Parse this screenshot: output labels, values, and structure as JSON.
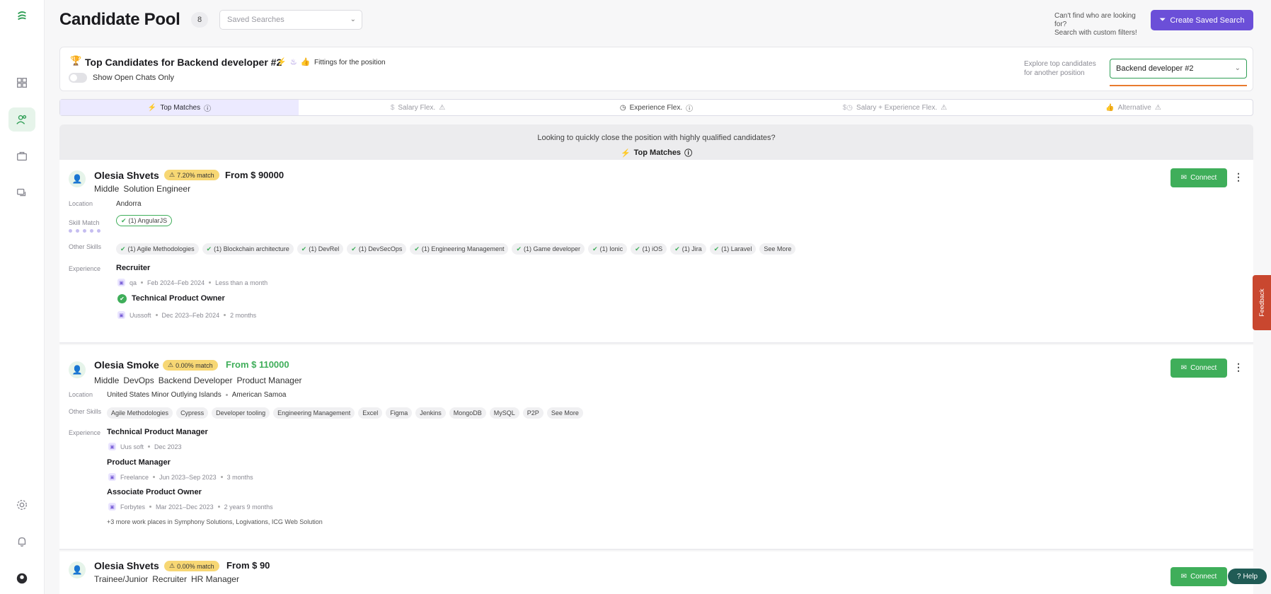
{
  "header": {
    "title": "Candidate Pool",
    "count": "8",
    "saved_searches_placeholder": "Saved Searches",
    "cant_find_line1": "Can't find who are looking for?",
    "cant_find_line2": "Search with custom filters!",
    "create_saved_search": "Create Saved Search"
  },
  "position": {
    "title": "Top Candidates for Backend developer #2",
    "fittings": "Fittings for the position",
    "show_open_chats": "Show Open Chats Only",
    "explore_line1": "Explore top candidates",
    "explore_line2": "for another position",
    "selected": "Backend developer #2"
  },
  "tabs": [
    {
      "label": "Top Matches",
      "active": true
    },
    {
      "label": "Salary Flex.",
      "active": false
    },
    {
      "label": "Experience Flex.",
      "active": false
    },
    {
      "label": "Salary + Experience Flex.",
      "active": false
    },
    {
      "label": "Alternative",
      "active": false
    }
  ],
  "banner": {
    "text": "Looking to quickly close the position with highly qualified candidates?",
    "sub": "Top Matches"
  },
  "labels": {
    "location": "Location",
    "skill_match": "Skill Match",
    "other_skills": "Other Skills",
    "experience": "Experience",
    "connect": "Connect",
    "see_more": "See More"
  },
  "candidates": [
    {
      "name": "Olesia Shvets",
      "match": "7.20% match",
      "salary": "From $ 90000",
      "roles": [
        "Middle",
        "Solution Engineer"
      ],
      "locations": [
        "Andorra"
      ],
      "skill_match": [
        "(1)  AngularJS"
      ],
      "other_skills": [
        "(1)  Agile Methodologies",
        "(1)  Blockchain architecture",
        "(1)  DevRel",
        "(1)  DevSecOps",
        "(1)  Engineering Management",
        "(1)  Game developer",
        "(1)  Ionic",
        "(1)  iOS",
        "(1)  Jira",
        "(1)  Laravel"
      ],
      "experience": [
        {
          "title": "Recruiter",
          "company": "qa",
          "period": "Feb 2024–Feb 2024",
          "duration": "Less than a month"
        },
        {
          "title": "Technical Product Owner",
          "company": "Uussoft",
          "period": "Dec 2023–Feb 2024",
          "duration": "2 months"
        }
      ]
    },
    {
      "name": "Olesia Smoke",
      "match": "0.00% match",
      "salary": "From $ 110000",
      "roles": [
        "Middle",
        "DevOps",
        "Backend Developer",
        "Product Manager"
      ],
      "locations": [
        "United States Minor Outlying Islands",
        "American Samoa"
      ],
      "other_skills": [
        "Agile Methodologies",
        "Cypress",
        "Developer tooling",
        "Engineering Management",
        "Excel",
        "Figma",
        "Jenkins",
        "MongoDB",
        "MySQL",
        "P2P"
      ],
      "experience": [
        {
          "title": "Technical Product Manager",
          "company": "Uus soft",
          "period": "Dec 2023",
          "duration": ""
        },
        {
          "title": "Product Manager",
          "company": "Freelance",
          "period": "Jun 2023–Sep 2023",
          "duration": "3 months"
        },
        {
          "title": "Associate Product Owner",
          "company": "Forbytes",
          "period": "Mar 2021–Dec 2023",
          "duration": "2 years 9 months"
        }
      ],
      "more_places": "+3 more work places in Symphony Solutions, Logivations, ICG Web Solution"
    },
    {
      "name": "Olesia Shvets",
      "match": "0.00% match",
      "salary": "From $ 90",
      "roles": [
        "Trainee/Junior",
        "Recruiter",
        "HR Manager"
      ]
    }
  ],
  "feedback": "Feedback",
  "help": "Help",
  "colors": {
    "accent": "#6b4fd8",
    "green": "#3fae5a",
    "match": "#f7d774",
    "feedback": "#c9472f"
  }
}
